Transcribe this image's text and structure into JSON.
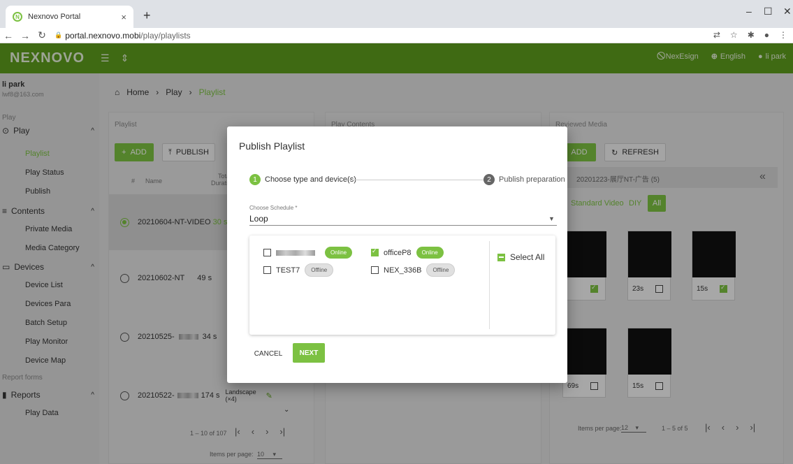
{
  "browser": {
    "tab_title": "Nexnovo Portal",
    "url_domain": "portal.nexnovo.mobi",
    "url_path": "/play/playlists"
  },
  "header": {
    "logo": "NEXNOVO",
    "nexesign": "NexEsign",
    "language": "English",
    "user": "li park"
  },
  "sidebar": {
    "user_name": "li park",
    "user_email": "lwf8@163.com",
    "section_play": "Play",
    "group_play": "Play",
    "play_items": [
      "Playlist",
      "Play Status",
      "Publish"
    ],
    "group_contents": "Contents",
    "contents_items": [
      "Private Media",
      "Media Category"
    ],
    "group_devices": "Devices",
    "devices_items": [
      "Device List",
      "Devices Para",
      "Batch Setup",
      "Play Monitor",
      "Device Map"
    ],
    "section_reports": "Report forms",
    "group_reports": "Reports",
    "reports_items": [
      "Play Data"
    ]
  },
  "breadcrumb": {
    "home": "Home",
    "play": "Play",
    "current": "Playlist"
  },
  "playlist_panel": {
    "title": "Playlist",
    "add": "ADD",
    "publish": "PUBLISH",
    "col_num": "#",
    "col_name": "Name",
    "col_total": "Total",
    "col_duration": "Duration",
    "rows": [
      {
        "name": "20210604-NT-VIDEO",
        "dur": "30 s"
      },
      {
        "name": "20210602-NT",
        "dur": "49 s"
      },
      {
        "name": "20210525-",
        "dur": "34 s"
      },
      {
        "name": "20210522-",
        "dur": "174 s",
        "orient": "Landscape",
        "count": "(×4)"
      }
    ],
    "range": "1 – 10 of 107",
    "items_per_page_label": "Items per page:",
    "items_per_page": "10"
  },
  "contents_panel": {
    "title": "Play Contents"
  },
  "media_panel": {
    "title": "Reviewed Media",
    "add": "ADD",
    "refresh": "REFRESH",
    "category": "20201223-展厅NT-广告 (5)",
    "filter_standard": "Standard Video",
    "filter_diy": "DIY",
    "filter_all": "All",
    "thumbs": [
      {
        "dur": "",
        "checked": true
      },
      {
        "dur": "23s",
        "checked": false
      },
      {
        "dur": "15s",
        "checked": true
      },
      {
        "dur": "69s",
        "checked": false
      },
      {
        "dur": "15s",
        "checked": false
      }
    ],
    "items_per_page_label": "Items per page:",
    "items_per_page": "12",
    "range": "1 – 5 of 5"
  },
  "dialog": {
    "title": "Publish Playlist",
    "step1_num": "1",
    "step1": "Choose type and device(s)",
    "step2_num": "2",
    "step2": "Publish preparation",
    "schedule_label": "Choose Schedule *",
    "schedule_value": "Loop",
    "devices": [
      {
        "name": "",
        "status": "Online",
        "checked": false
      },
      {
        "name": "officeP8",
        "status": "Online",
        "checked": true
      },
      {
        "name": "TEST7",
        "status": "Offline",
        "checked": false
      },
      {
        "name": "NEX_336B",
        "status": "Offline",
        "checked": false
      }
    ],
    "select_all": "Select All",
    "cancel": "CANCEL",
    "next": "NEXT"
  },
  "colors": {
    "brand": "#5d9d1d",
    "accent": "#7cc142"
  }
}
